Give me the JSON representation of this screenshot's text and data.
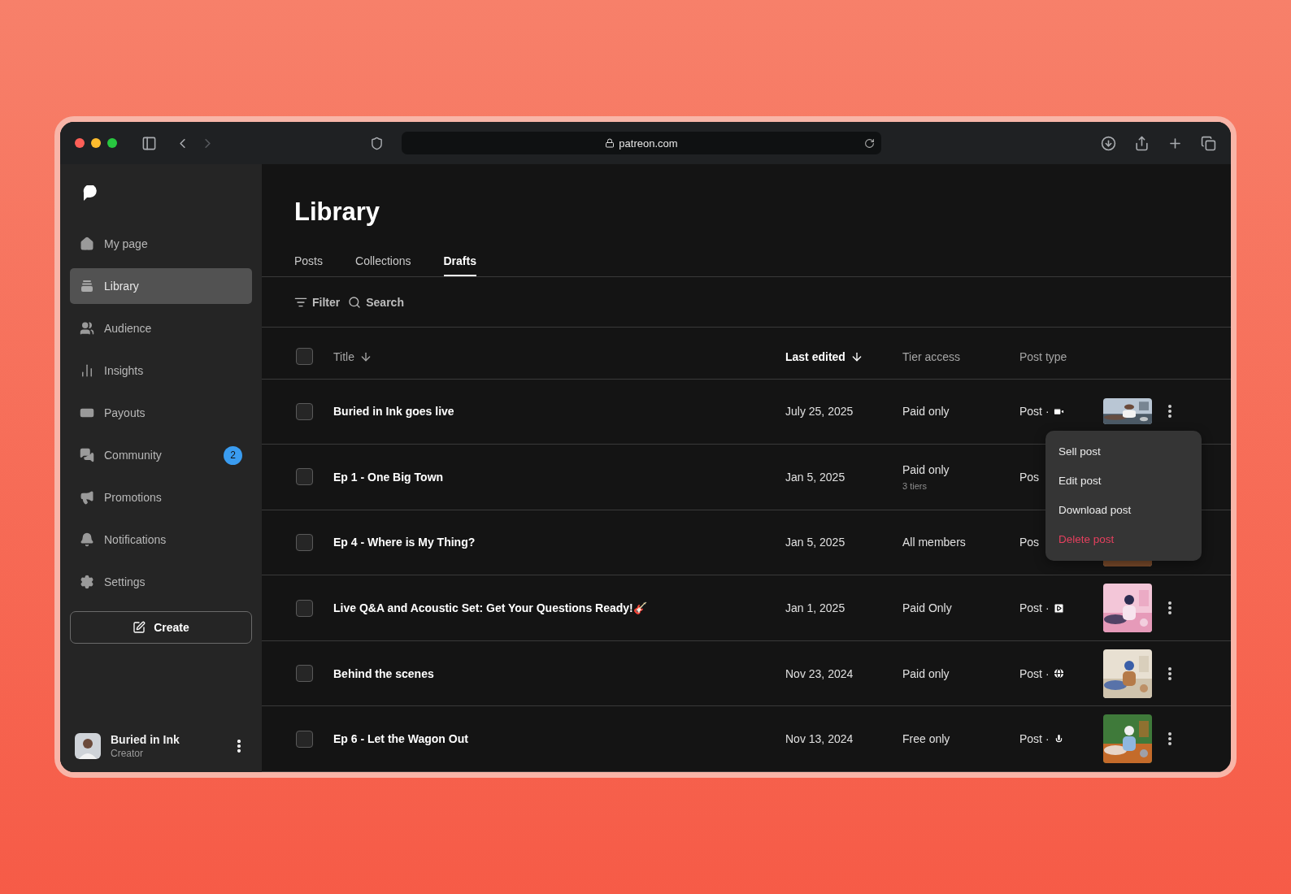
{
  "browser": {
    "url": "patreon.com"
  },
  "sidebar": {
    "items": [
      {
        "label": "My page",
        "selected": false
      },
      {
        "label": "Library",
        "selected": true
      },
      {
        "label": "Audience",
        "selected": false
      },
      {
        "label": "Insights",
        "selected": false
      },
      {
        "label": "Payouts",
        "selected": false
      },
      {
        "label": "Community",
        "selected": false,
        "badge": "2"
      },
      {
        "label": "Promotions",
        "selected": false
      },
      {
        "label": "Notifications",
        "selected": false
      },
      {
        "label": "Settings",
        "selected": false
      }
    ],
    "create_button": "Create",
    "profile": {
      "name": "Buried in Ink",
      "role": "Creator"
    }
  },
  "page": {
    "title": "Library",
    "tabs": [
      {
        "label": "Posts",
        "selected": false
      },
      {
        "label": "Collections",
        "selected": false
      },
      {
        "label": "Drafts",
        "selected": true
      }
    ],
    "toolbar": {
      "filter": "Filter",
      "search": "Search"
    }
  },
  "table": {
    "select_all": {
      "checked": false
    },
    "columns": [
      {
        "label": "Title",
        "sortable": true,
        "selected": false
      },
      {
        "label": "Last edited",
        "sortable": true,
        "selected": true
      },
      {
        "label": "Tier access",
        "sortable": false,
        "selected": false
      },
      {
        "label": "Post type",
        "sortable": false,
        "selected": false
      }
    ],
    "rows": [
      {
        "kind": "video",
        "checked": false,
        "title": "Buried in Ink goes live",
        "edited": "July 25, 2025",
        "tier": "Paid only",
        "post_type": "Post ·",
        "thumbnail": true,
        "menu_button": true
      },
      {
        "kind": "covered",
        "checked": false,
        "title": "Ep 1 - One Big Town",
        "edited": "Jan 5, 2025",
        "tier": "Paid only",
        "tier_note": "3 tiers",
        "post_type": "Pos",
        "thumbnail": false,
        "menu_button": false
      },
      {
        "kind": "covered",
        "checked": false,
        "title": "Ep 4 - Where is My Thing?",
        "edited": "Jan 5, 2025",
        "tier": "All members",
        "post_type": "Pos",
        "thumbnail": true,
        "menu_button": false
      },
      {
        "kind": "play",
        "checked": false,
        "title": "Live Q&A and Acoustic Set: Get Your Questions Ready!🎸",
        "edited": "Jan 1, 2025",
        "tier": "Paid Only",
        "post_type": "Post ·",
        "thumbnail": true,
        "menu_button": true
      },
      {
        "kind": "ball",
        "checked": false,
        "title": "Behind the scenes",
        "edited": "Nov 23, 2024",
        "tier": "Paid only",
        "post_type": "Post ·",
        "thumbnail": true,
        "menu_button": true
      },
      {
        "kind": "mic",
        "checked": false,
        "title": "Ep 6 - Let the Wagon Out",
        "edited": "Nov 13, 2024",
        "tier": "Free only",
        "post_type": "Post ·",
        "thumbnail": true,
        "menu_button": true
      }
    ]
  },
  "context_menu": {
    "items": [
      {
        "label": "Sell post",
        "kind": "normal"
      },
      {
        "label": "Edit post",
        "kind": "normal"
      },
      {
        "label": "Download post",
        "kind": "normal"
      },
      {
        "label": "Delete post",
        "kind": "danger"
      }
    ]
  }
}
